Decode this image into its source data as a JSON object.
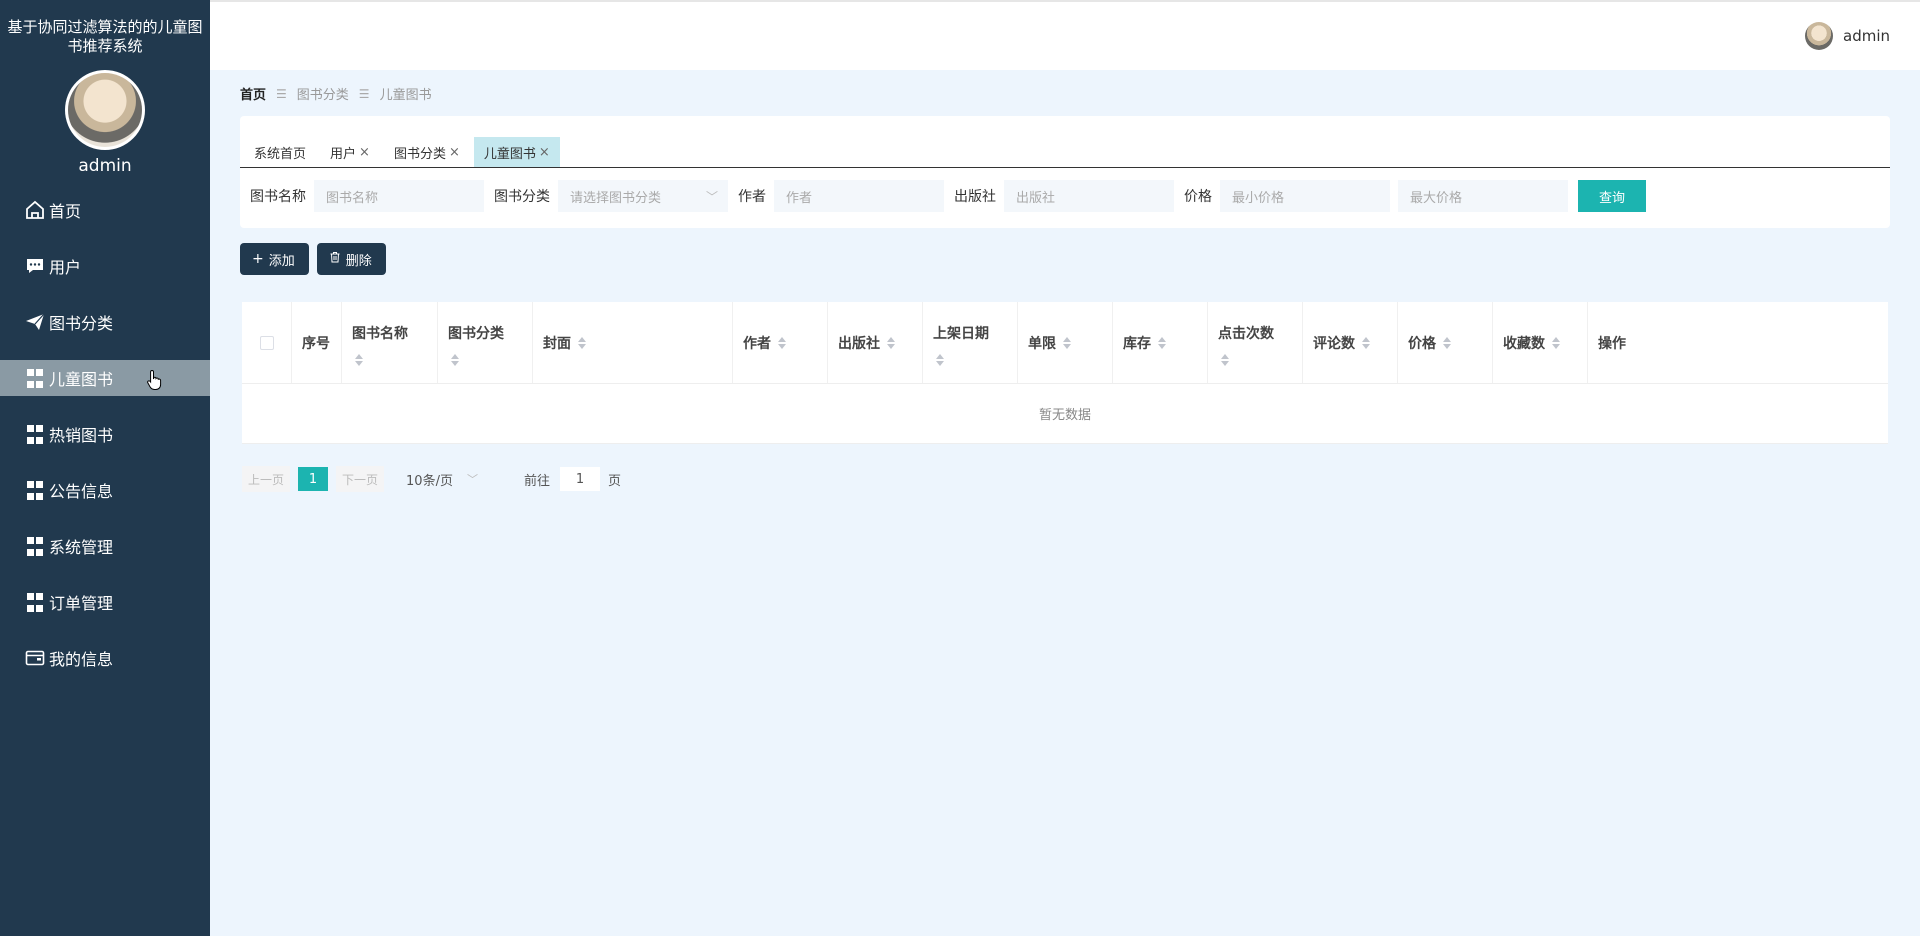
{
  "sidebar": {
    "title": "基于协同过滤算法的的儿童图书推荐系统",
    "username": "admin",
    "items": [
      {
        "label": "首页",
        "icon": "home-icon"
      },
      {
        "label": "用户",
        "icon": "chat-icon"
      },
      {
        "label": "图书分类",
        "icon": "paper-plane-icon"
      },
      {
        "label": "儿童图书",
        "icon": "grid-icon",
        "active": true
      },
      {
        "label": "热销图书",
        "icon": "grid-icon"
      },
      {
        "label": "公告信息",
        "icon": "grid-icon"
      },
      {
        "label": "系统管理",
        "icon": "grid-icon"
      },
      {
        "label": "订单管理",
        "icon": "grid-icon"
      },
      {
        "label": "我的信息",
        "icon": "wallet-icon"
      }
    ]
  },
  "topbar": {
    "username": "admin"
  },
  "breadcrumb": {
    "home": "首页",
    "items": [
      "图书分类",
      "儿童图书"
    ]
  },
  "tabs": [
    {
      "label": "系统首页",
      "closable": false
    },
    {
      "label": "用户",
      "closable": true
    },
    {
      "label": "图书分类",
      "closable": true
    },
    {
      "label": "儿童图书",
      "closable": true,
      "active": true
    }
  ],
  "tab_close": "×",
  "search": {
    "name_label": "图书名称",
    "name_placeholder": "图书名称",
    "category_label": "图书分类",
    "category_placeholder": "请选择图书分类",
    "author_label": "作者",
    "author_placeholder": "作者",
    "publisher_label": "出版社",
    "publisher_placeholder": "出版社",
    "price_label": "价格",
    "price_min_placeholder": "最小价格",
    "price_max_placeholder": "最大价格",
    "query_button": "查询"
  },
  "actions": {
    "add": "添加",
    "delete": "删除"
  },
  "table": {
    "columns": [
      "序号",
      "图书名称",
      "图书分类",
      "封面",
      "作者",
      "出版社",
      "上架日期",
      "单限",
      "库存",
      "点击次数",
      "评论数",
      "价格",
      "收藏数",
      "操作"
    ],
    "empty_text": "暂无数据"
  },
  "pagination": {
    "prev": "上一页",
    "current": "1",
    "next": "下一页",
    "page_size": "10条/页",
    "goto_label": "前往",
    "goto_value": "1",
    "page_unit": "页"
  },
  "colors": {
    "sidebar": "#21394e",
    "accent": "#1cb4b0",
    "background": "#edf5fd"
  }
}
